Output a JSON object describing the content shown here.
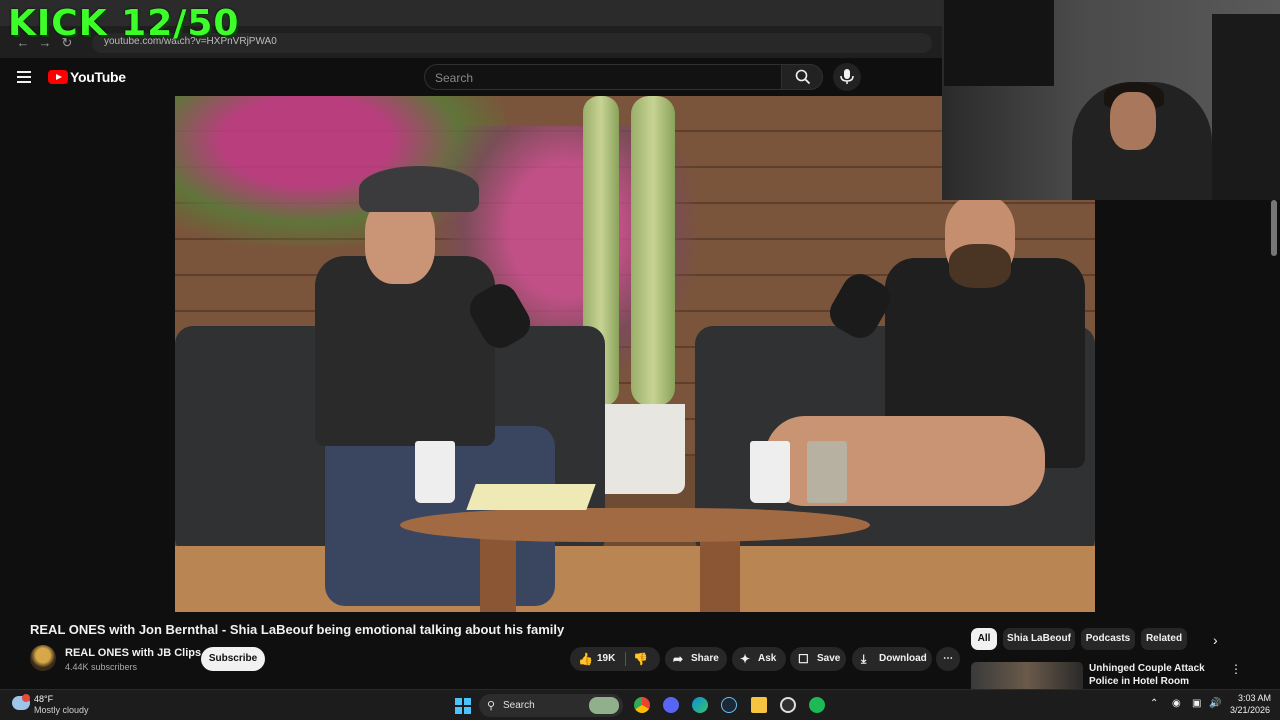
{
  "overlay": {
    "kick_counter": "KICK 12/50"
  },
  "browser": {
    "url": "youtube.com/watch?v=HXPnVRjPWA0"
  },
  "header": {
    "logo_text": "YouTube",
    "search_placeholder": "Search",
    "icons": [
      "menu-icon",
      "search-icon",
      "mic-icon"
    ]
  },
  "video": {
    "title": "REAL ONES with Jon Bernthal - Shia LaBeouf being emotional talking about his family"
  },
  "channel": {
    "name": "REAL ONES with JB Clips",
    "subscribers": "4.44K subscribers",
    "subscribe_label": "Subscribe"
  },
  "actions": {
    "likes": "19K",
    "share": "Share",
    "ask": "Ask",
    "save": "Save",
    "download": "Download"
  },
  "sidebar": {
    "chips": [
      "All",
      "Shia LaBeouf",
      "Podcasts",
      "Related"
    ],
    "active_chip": "All",
    "recommendation_title": "Unhinged Couple Attack Police in Hotel Room"
  },
  "taskbar": {
    "weather_temp": "48°F",
    "weather_desc": "Mostly cloudy",
    "search_placeholder": "Search",
    "time": "3:03 AM",
    "date": "3/21/2026",
    "apps": [
      "chrome-icon",
      "discord-icon",
      "edge-icon",
      "steam-icon",
      "file-explorer-icon",
      "obs-icon",
      "spotify-icon"
    ]
  },
  "colors": {
    "accent": "#ff0000",
    "kick_green": "#3cff2a",
    "background": "#0f0f0f"
  }
}
